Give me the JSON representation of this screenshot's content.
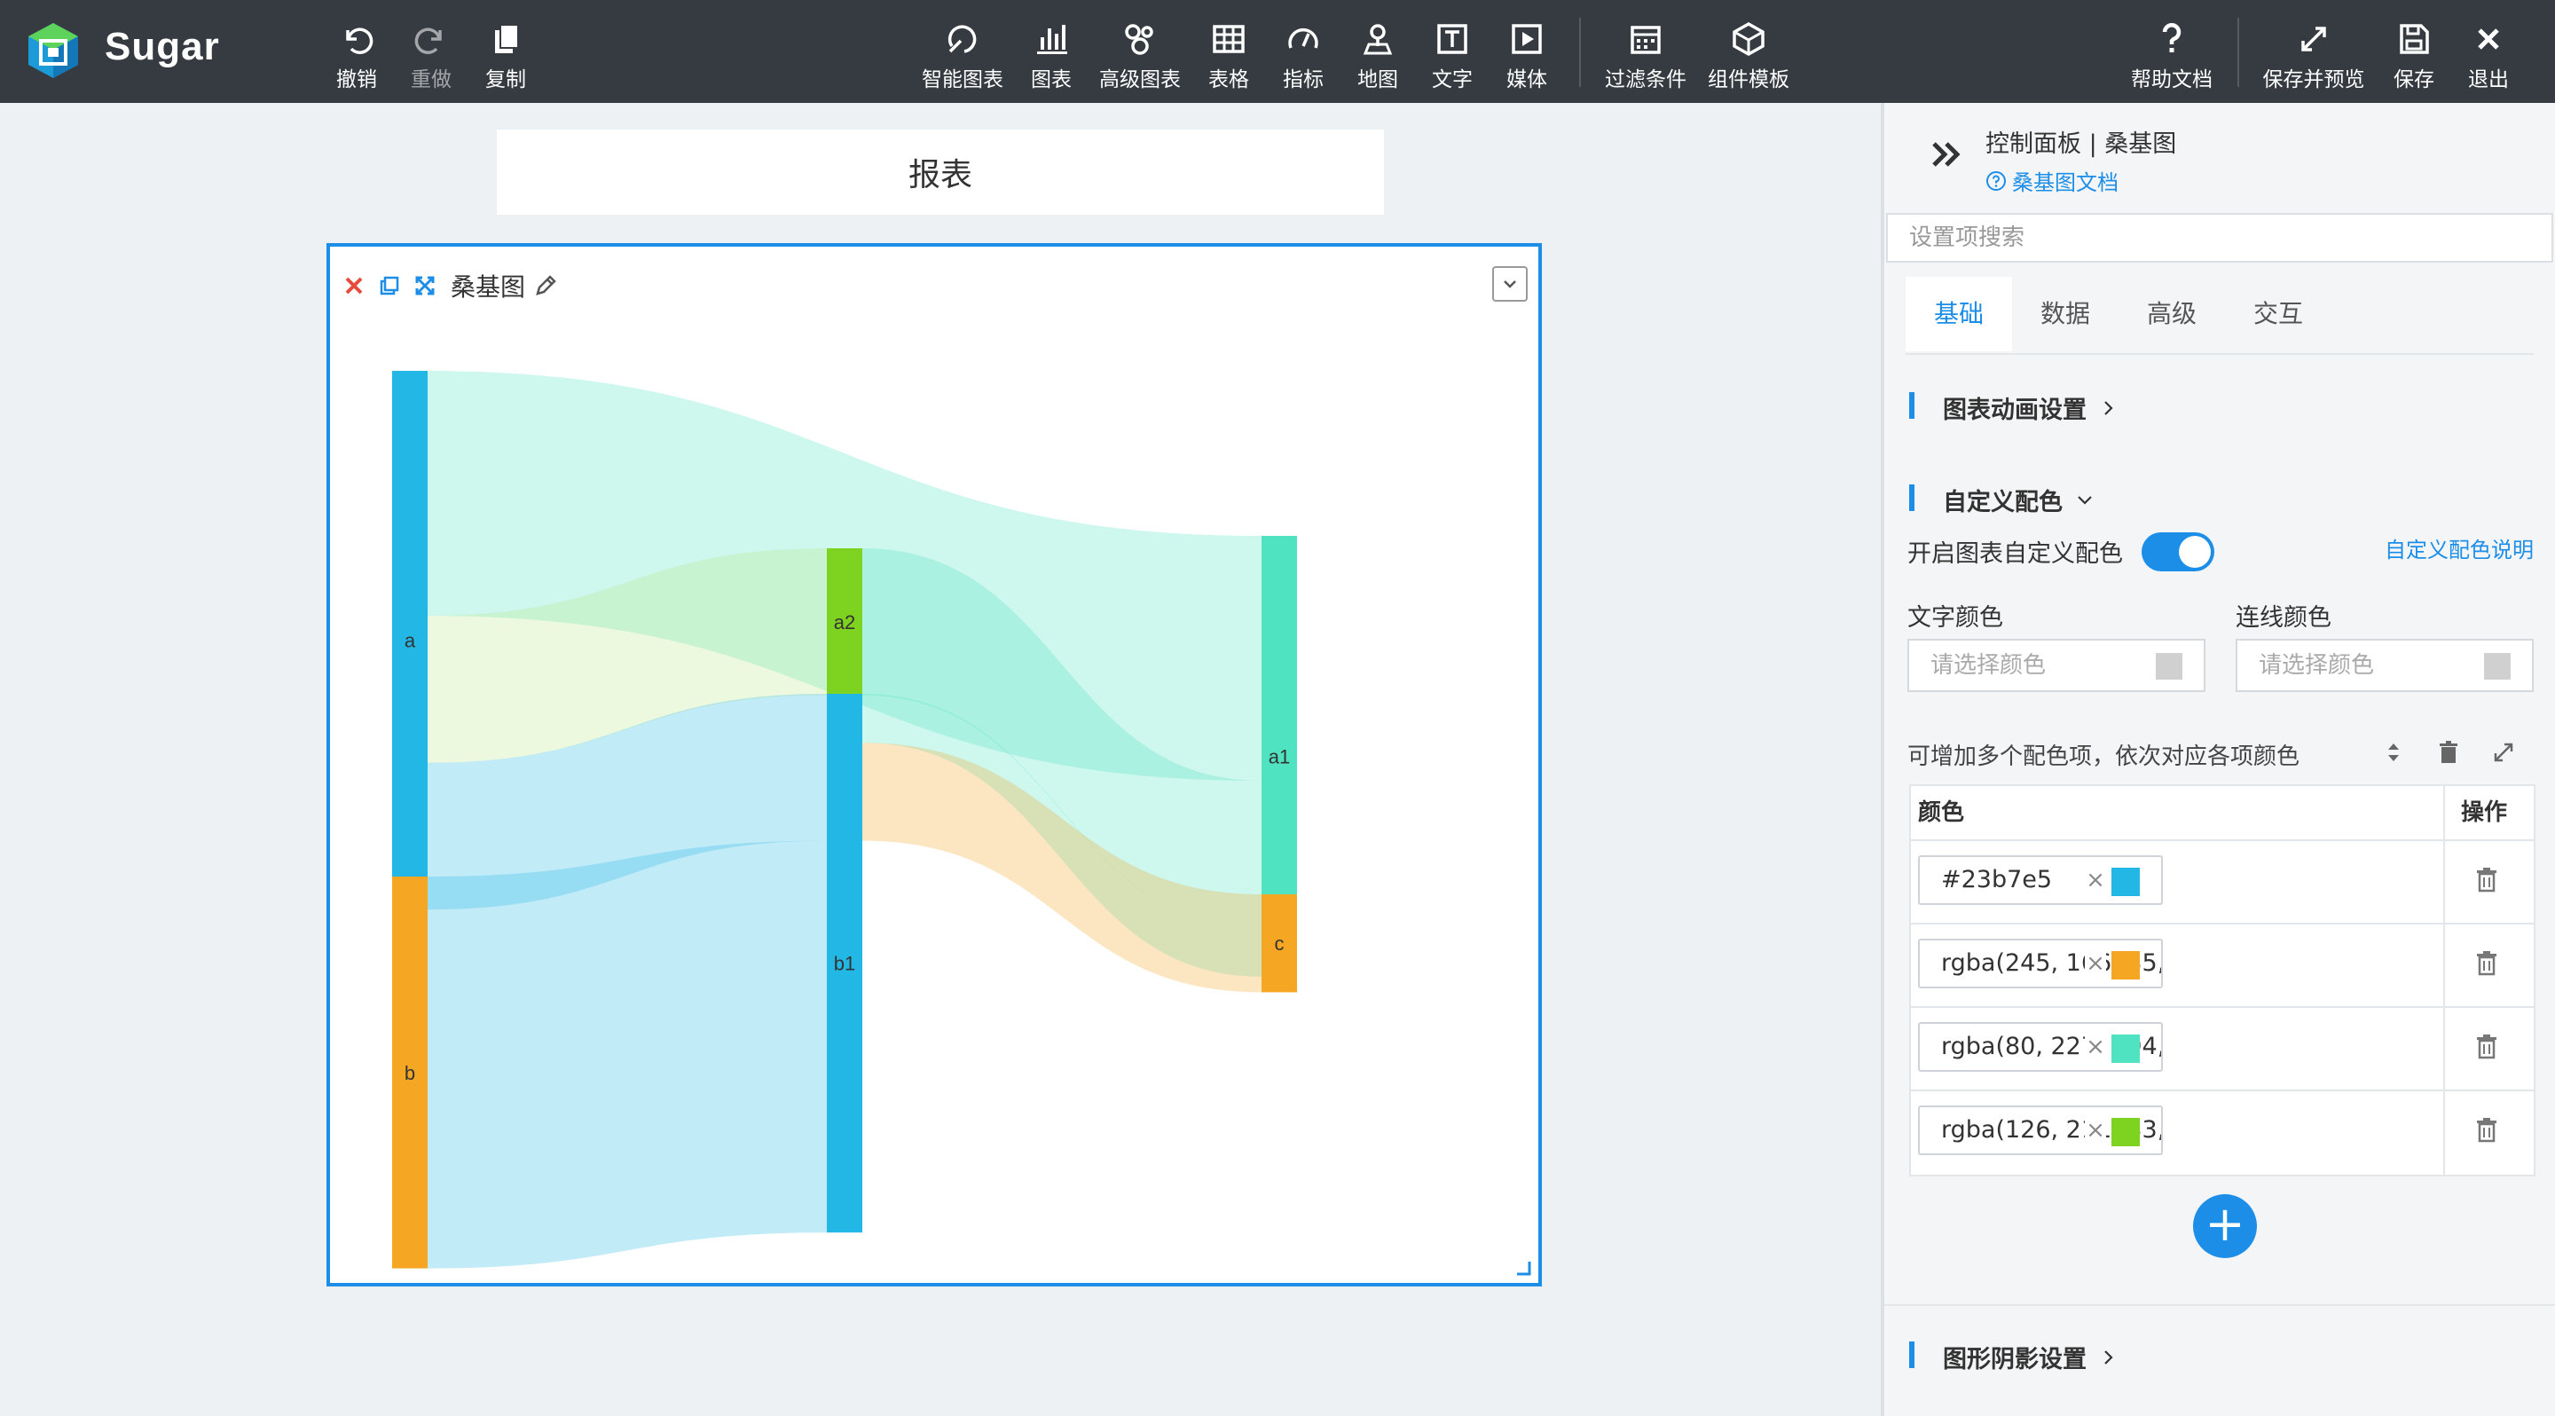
{
  "app": {
    "name": "Sugar"
  },
  "toolbar": {
    "undo": "撤销",
    "redo": "重做",
    "copy": "复制",
    "smart_chart": "智能图表",
    "chart": "图表",
    "advanced_chart": "高级图表",
    "table": "表格",
    "indicator": "指标",
    "map": "地图",
    "text": "文字",
    "media": "媒体",
    "filter": "过滤条件",
    "component_template": "组件模板",
    "help_doc": "帮助文档",
    "save_preview": "保存并预览",
    "save": "保存",
    "exit": "退出"
  },
  "report": {
    "title": "报表"
  },
  "chart_card": {
    "title": "桑基图"
  },
  "chart_data": {
    "type": "sankey",
    "nodes": [
      {
        "name": "a",
        "color": "#23b7e5"
      },
      {
        "name": "b",
        "color": "rgba(245,166,35,1)"
      },
      {
        "name": "a2",
        "color": "#7ed321"
      },
      {
        "name": "b1",
        "color": "#23b7e5"
      },
      {
        "name": "a1",
        "color": "#50e3c2"
      },
      {
        "name": "c",
        "color": "rgba(245,166,35,1)"
      }
    ],
    "links": [
      {
        "source": "a",
        "target": "a1",
        "value": 5
      },
      {
        "source": "a",
        "target": "a2",
        "value": 3
      },
      {
        "source": "a",
        "target": "b1",
        "value": 3
      },
      {
        "source": "b",
        "target": "b1",
        "value": 8
      },
      {
        "source": "a2",
        "target": "a1",
        "value": 3
      },
      {
        "source": "b1",
        "target": "a1",
        "value": 1
      },
      {
        "source": "b1",
        "target": "c",
        "value": 2
      }
    ]
  },
  "panel": {
    "title": "控制面板 | 桑基图",
    "doc_link": "桑基图文档",
    "search_placeholder": "设置项搜索",
    "tabs": [
      "基础",
      "数据",
      "高级",
      "交互"
    ],
    "active_tab": "基础",
    "sections": {
      "animation": "图表动画设置",
      "custom_color": "自定义配色",
      "shadow": "图形阴影设置"
    },
    "enable_custom_color_label": "开启图表自定义配色",
    "enable_custom_color": true,
    "custom_color_help": "自定义配色说明",
    "text_color_label": "文字颜色",
    "line_color_label": "连线颜色",
    "color_placeholder": "请选择颜色",
    "hint": "可增加多个配色项，依次对应各项颜色",
    "table_headers": {
      "color": "颜色",
      "action": "操作"
    },
    "colors": [
      {
        "text": "#23b7e5",
        "swatch": "#23b7e5"
      },
      {
        "text": "rgba(245, 166, 35, 1)",
        "swatch": "#f5a623"
      },
      {
        "text": "rgba(80, 227, 194, 1)",
        "swatch": "#50e3c2"
      },
      {
        "text": "rgba(126, 211, 33, 1)",
        "swatch": "#7ed321"
      }
    ],
    "add_button": "+"
  }
}
